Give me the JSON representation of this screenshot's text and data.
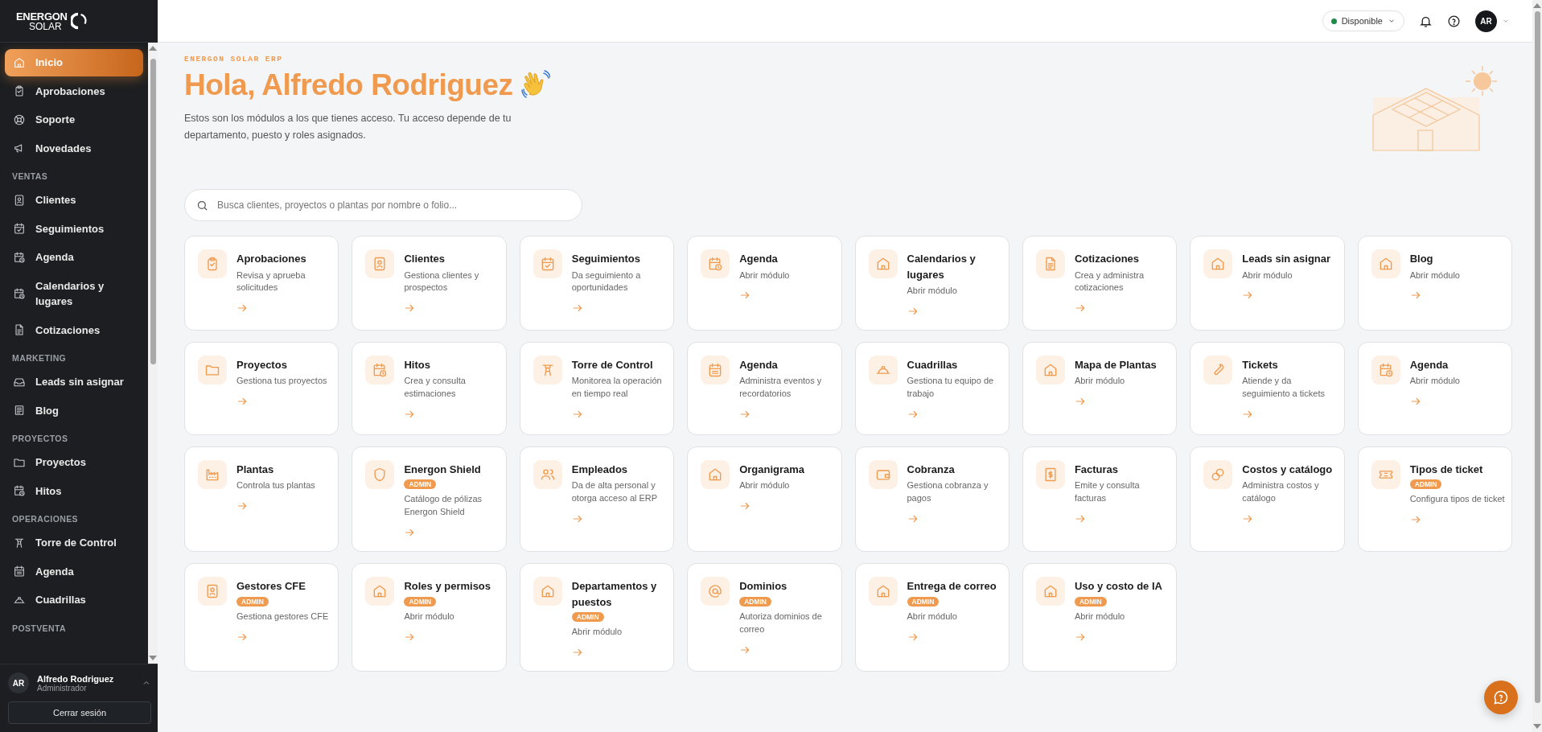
{
  "sidebar": {
    "logo": {
      "line_1": "ENERGON",
      "line_2": "SOLAR"
    },
    "sections": [
      {
        "items": [
          {
            "label": "Inicio",
            "selected": true
          },
          {
            "label": "Aprobaciones",
            "selected": false
          },
          {
            "label": "Soporte",
            "selected": false
          },
          {
            "label": "Novedades",
            "selected": false
          }
        ]
      },
      {
        "heading": "VENTAS",
        "items": [
          {
            "label": "Clientes",
            "selected": false
          },
          {
            "label": "Seguimientos",
            "selected": false
          },
          {
            "label": "Agenda",
            "selected": false
          },
          {
            "label": "Calendarios y lugares",
            "selected": false
          },
          {
            "label": "Cotizaciones",
            "selected": false
          }
        ]
      },
      {
        "heading": "MARKETING",
        "items": [
          {
            "label": "Leads sin asignar",
            "selected": false
          },
          {
            "label": "Blog",
            "selected": false
          }
        ]
      },
      {
        "heading": "PROYECTOS",
        "items": [
          {
            "label": "Proyectos",
            "selected": false
          },
          {
            "label": "Hitos",
            "selected": false
          }
        ]
      },
      {
        "heading": "OPERACIONES",
        "items": [
          {
            "label": "Torre de Control",
            "selected": false
          },
          {
            "label": "Agenda",
            "selected": false
          },
          {
            "label": "Cuadrillas",
            "selected": false
          }
        ]
      },
      {
        "heading": "POSTVENTA"
      }
    ],
    "user": {
      "initials": "AR",
      "name": "Alfredo Rodriguez",
      "role": "Administrador"
    },
    "logout_button": "Cerrar sesión"
  },
  "header": {
    "status": "Disponible",
    "avatar": "AR"
  },
  "hero": {
    "eyebrow": "ENERGON SOLAR ERP",
    "title": "Hola, Alfredo Rodriguez",
    "description": "Estos son los módulos a los que tienes acceso. Tu acceso depende de tu departamento, puesto y roles asignados."
  },
  "search": {
    "placeholder": "Busca clientes, proyectos o plantas por nombre o folio..."
  },
  "modules": [
    {
      "title": "Aprobaciones",
      "description": "Revisa y aprueba solicitudes"
    },
    {
      "title": "Clientes",
      "description": "Gestiona clientes y prospectos"
    },
    {
      "title": "Seguimientos",
      "description": "Da seguimiento a oportunidades"
    },
    {
      "title": "Agenda",
      "description": "Abrir módulo"
    },
    {
      "title": "Calendarios y lugares",
      "description": "Abrir módulo"
    },
    {
      "title": "Cotizaciones",
      "description": "Crea y administra cotizaciones"
    },
    {
      "title": "Leads sin asignar",
      "description": "Abrir módulo"
    },
    {
      "title": "Blog",
      "description": "Abrir módulo"
    },
    {
      "title": "Proyectos",
      "description": "Gestiona tus proyectos"
    },
    {
      "title": "Hitos",
      "description": "Crea y consulta estimaciones"
    },
    {
      "title": "Torre de Control",
      "description": "Monitorea la operación en tiempo real"
    },
    {
      "title": "Agenda",
      "description": "Administra eventos y recordatorios"
    },
    {
      "title": "Cuadrillas",
      "description": "Gestiona tu equipo de trabajo"
    },
    {
      "title": "Mapa de Plantas",
      "description": "Abrir módulo"
    },
    {
      "title": "Tickets",
      "description": "Atiende y da seguimiento a tickets"
    },
    {
      "title": "Agenda",
      "description": "Abrir módulo"
    },
    {
      "title": "Plantas",
      "description": "Controla tus plantas"
    },
    {
      "title": "Energon Shield",
      "badge": "ADMIN",
      "description": "Catálogo de pólizas Energon Shield"
    },
    {
      "title": "Empleados",
      "description": "Da de alta personal y otorga acceso al ERP"
    },
    {
      "title": "Organigrama",
      "description": "Abrir módulo"
    },
    {
      "title": "Cobranza",
      "description": "Gestiona cobranza y pagos"
    },
    {
      "title": "Facturas",
      "description": "Emite y consulta facturas"
    },
    {
      "title": "Costos y catálogo",
      "description": "Administra costos y catálogo"
    },
    {
      "title": "Tipos de ticket",
      "badge": "ADMIN",
      "description": "Configura tipos de ticket"
    },
    {
      "title": "Gestores CFE",
      "badge": "ADMIN",
      "description": "Gestiona gestores CFE"
    },
    {
      "title": "Roles y permisos",
      "badge": "ADMIN",
      "description": "Abrir módulo"
    },
    {
      "title": "Departamentos y puestos",
      "badge": "ADMIN",
      "description": "Abrir módulo"
    },
    {
      "title": "Dominios",
      "badge": "ADMIN",
      "description": "Autoriza dominios de correo"
    },
    {
      "title": "Entrega de correo",
      "badge": "ADMIN",
      "description": "Abrir módulo"
    },
    {
      "title": "Uso y costo de IA",
      "badge": "ADMIN",
      "description": "Abrir módulo"
    }
  ]
}
